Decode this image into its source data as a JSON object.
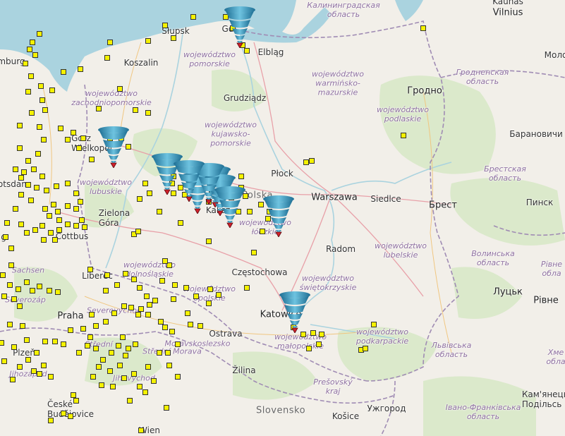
{
  "map": {
    "countries": [
      {
        "id": "pl",
        "label": "Polska"
      },
      {
        "id": "sk",
        "label": "Slovensko"
      }
    ],
    "cities": [
      {
        "id": "vilnius",
        "label": "Vilnius"
      },
      {
        "id": "kaunas",
        "label": "Kaunas"
      },
      {
        "id": "slupsk",
        "label": "Słupsk"
      },
      {
        "id": "koszalin",
        "label": "Koszalin"
      },
      {
        "id": "elblag",
        "label": "Elbląg"
      },
      {
        "id": "grudziadz",
        "label": "Grudziądz"
      },
      {
        "id": "grodno",
        "label": "Гродно"
      },
      {
        "id": "baranovichi",
        "label": "Барановичи"
      },
      {
        "id": "plock",
        "label": "Płock"
      },
      {
        "id": "warszawa",
        "label": "Warszawa"
      },
      {
        "id": "siedlce",
        "label": "Siedlce"
      },
      {
        "id": "brest",
        "label": "Брест"
      },
      {
        "id": "pinsk",
        "label": "Пинск"
      },
      {
        "id": "zielona",
        "label": "Zielona\nGóra"
      },
      {
        "id": "kalisz",
        "label": "Kalisz"
      },
      {
        "id": "radom",
        "label": "Radom"
      },
      {
        "id": "czestochowa",
        "label": "Częstochowa"
      },
      {
        "id": "katowice",
        "label": "Katowice"
      },
      {
        "id": "praha",
        "label": "Praha"
      },
      {
        "id": "ostrava",
        "label": "Ostrava"
      },
      {
        "id": "zilina",
        "label": "Žilina"
      },
      {
        "id": "kosice",
        "label": "Košice"
      },
      {
        "id": "uzhhorod",
        "label": "Ужгород"
      },
      {
        "id": "lutsk",
        "label": "Луцьк"
      },
      {
        "id": "rivne",
        "label": "Рівне"
      },
      {
        "id": "molo",
        "label": "Моло"
      },
      {
        "id": "gorzow",
        "label": "Gorz\nWielkopol"
      },
      {
        "id": "potsdam",
        "label": "Potsdam"
      },
      {
        "id": "cottbus",
        "label": "Cottbus"
      },
      {
        "id": "liberec",
        "label": "Liberec"
      },
      {
        "id": "plzen",
        "label": "Plzeň"
      },
      {
        "id": "ceske",
        "label": "České\nBudějovice"
      },
      {
        "id": "wien",
        "label": "Wien"
      },
      {
        "id": "kamyanets",
        "label": "Кам'янець-\nПодільсь"
      },
      {
        "id": "gdansk",
        "label": "Gd"
      },
      {
        "id": "hamburg",
        "label": "mburg"
      },
      {
        "id": "g",
        "label": "g"
      }
    ],
    "regions": [
      {
        "id": "kaliningrad",
        "label": "Калининградская\nобласть"
      },
      {
        "id": "pomorskie",
        "label": "województwo\npomorskie"
      },
      {
        "id": "warminsko",
        "label": "województwo\nwarmińsko-\nmazurskie"
      },
      {
        "id": "grodnenskaya",
        "label": "Гродненская\nобласть"
      },
      {
        "id": "zachodnio",
        "label": "województwo\nzachodniopomorskie"
      },
      {
        "id": "podlaskie",
        "label": "województwo\npodlaskie"
      },
      {
        "id": "kujawsko",
        "label": "województwo\nkujawsko-\npomorskie"
      },
      {
        "id": "brestskaya",
        "label": "Брестская\nобласть"
      },
      {
        "id": "lubuskie",
        "label": "województwo\nlubuskie"
      },
      {
        "id": "lodzkie",
        "label": "województwo\nłódzkie"
      },
      {
        "id": "lubelskie",
        "label": "województwo\nlubelskie"
      },
      {
        "id": "volynska",
        "label": "Волинська\nобласть"
      },
      {
        "id": "rivnenska",
        "label": "Рівне\nобла"
      },
      {
        "id": "dolnoslaskie",
        "label": "województwo\ndolnośląskie"
      },
      {
        "id": "opolskie",
        "label": "województwo\nopolskie"
      },
      {
        "id": "swietokrzyskie",
        "label": "województwo\nświętokrzyskie"
      },
      {
        "id": "malopolskie",
        "label": "województwo\nmałopolskie"
      },
      {
        "id": "podkarpackie",
        "label": "województwo\npodkarpackie"
      },
      {
        "id": "lvivska",
        "label": "Львівська\nобласть"
      },
      {
        "id": "khmelnytska",
        "label": "Хме\nобла"
      },
      {
        "id": "ivanofrank",
        "label": "Івано-Франківська\nобласть"
      },
      {
        "id": "presovsky",
        "label": "Prešovský\nkraj"
      },
      {
        "id": "sachsen",
        "label": "Sachsen"
      },
      {
        "id": "severozapad",
        "label": "Severozáp"
      },
      {
        "id": "severovychod",
        "label": "Severovýchod"
      },
      {
        "id": "stredni",
        "label": "Střední"
      },
      {
        "id": "jihozapad",
        "label": "Jihozápad"
      },
      {
        "id": "jihovychod",
        "label": "Jihovýchod"
      },
      {
        "id": "moravskoslezsko",
        "label": "Moravskoslezsko"
      },
      {
        "id": "strednimorava",
        "label": "Střední Morava"
      }
    ],
    "tornado_reports": 11,
    "colors": {
      "land": "#f2efe9",
      "water": "#aad3df",
      "forest": "#d7e8c6",
      "border": "#a08cb4",
      "marker_fill": "#f5f200",
      "tornado": "#3a8fb5",
      "pin": "#d0202a"
    }
  }
}
